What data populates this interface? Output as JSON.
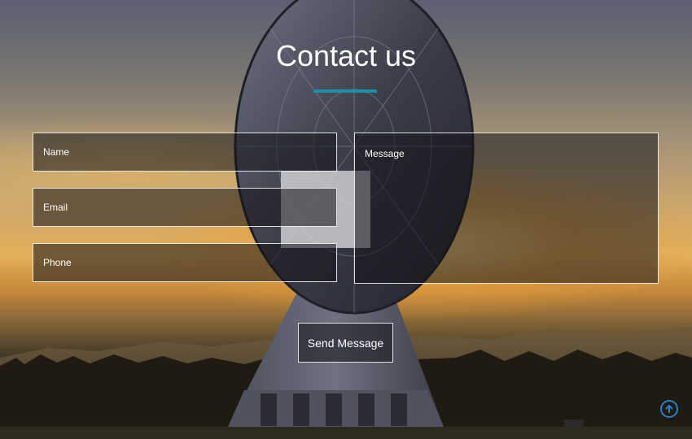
{
  "page": {
    "title": "Contact us"
  },
  "form": {
    "name_placeholder": "Name",
    "email_placeholder": "Email",
    "phone_placeholder": "Phone",
    "message_placeholder": "Message",
    "send_label": "Send Message"
  },
  "colors": {
    "accent": "#1f8fa8",
    "scroll_icon": "#2d7fbf"
  },
  "icons": {
    "scroll_top": "arrow-up-circle-icon"
  }
}
